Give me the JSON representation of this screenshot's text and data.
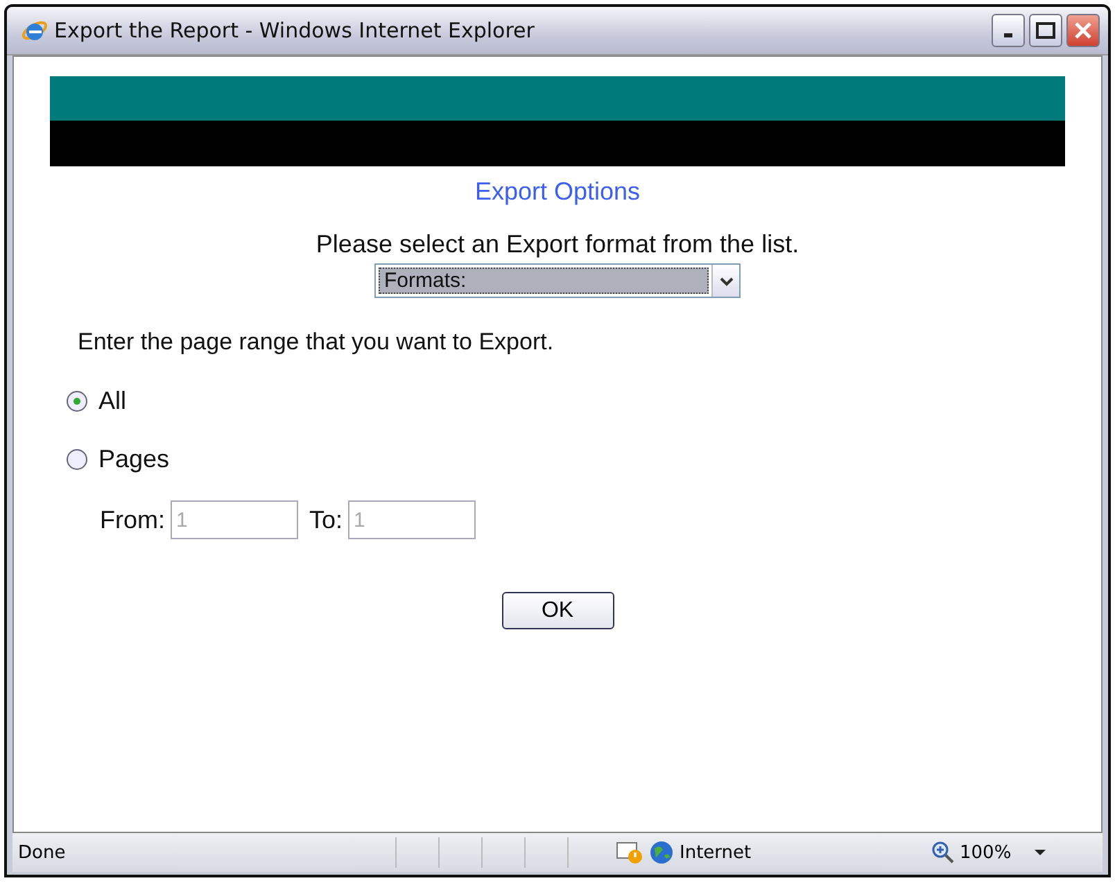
{
  "window": {
    "title": "Export the Report - Windows Internet Explorer"
  },
  "heading": "Export Options",
  "format_prompt": "Please select an Export format from the list.",
  "format_select": {
    "value": "Formats:"
  },
  "range_prompt": "Enter the page range that you want to Export.",
  "range_options": [
    {
      "label": "All",
      "selected": true
    },
    {
      "label": "Pages",
      "selected": false
    }
  ],
  "from": {
    "label": "From:",
    "value": "1",
    "disabled": true
  },
  "to": {
    "label": "To:",
    "value": "1",
    "disabled": true
  },
  "ok_button": "OK",
  "status_bar": {
    "status": "Done",
    "zone": "Internet",
    "zoom": "100%"
  }
}
